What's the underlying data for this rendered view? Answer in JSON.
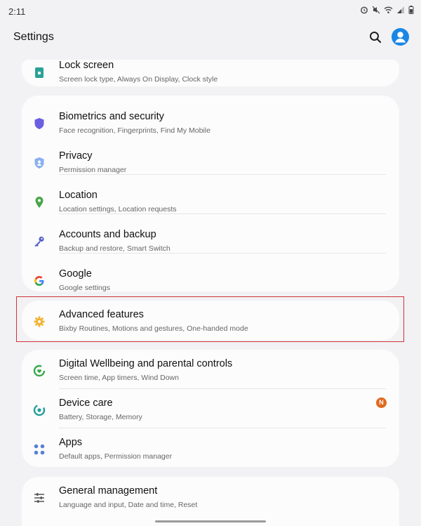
{
  "status_bar": {
    "time": "2:11",
    "icons": [
      "alarm-icon",
      "mute-icon",
      "wifi-icon",
      "signal-icon",
      "battery-icon"
    ]
  },
  "header": {
    "title": "Settings",
    "search_icon": "search-icon",
    "avatar_icon": "account-icon",
    "accent": "#1a86e6"
  },
  "items": {
    "lock_screen": {
      "title": "Lock screen",
      "subtitle": "Screen lock type, Always On Display, Clock style",
      "icon": "lock-icon",
      "color": "#2aa198"
    },
    "biometrics": {
      "title": "Biometrics and security",
      "subtitle": "Face recognition, Fingerprints, Find My Mobile",
      "icon": "shield-icon",
      "color": "#6a5fe0"
    },
    "privacy": {
      "title": "Privacy",
      "subtitle": "Permission manager",
      "icon": "privacy-shield-icon",
      "color": "#5a8ee8"
    },
    "location": {
      "title": "Location",
      "subtitle": "Location settings, Location requests",
      "icon": "location-pin-icon",
      "color": "#4aa64a"
    },
    "accounts": {
      "title": "Accounts and backup",
      "subtitle": "Backup and restore, Smart Switch",
      "icon": "key-icon",
      "color": "#5461c8"
    },
    "google": {
      "title": "Google",
      "subtitle": "Google settings",
      "icon": "google-icon",
      "color": "#4285f4"
    },
    "advanced": {
      "title": "Advanced features",
      "subtitle": "Bixby Routines, Motions and gestures, One-handed mode",
      "icon": "puzzle-gear-icon",
      "color": "#f2b233"
    },
    "wellbeing": {
      "title": "Digital Wellbeing and parental controls",
      "subtitle": "Screen time, App timers, Wind Down",
      "icon": "wellbeing-icon",
      "color": "#38a84a"
    },
    "device_care": {
      "title": "Device care",
      "subtitle": "Battery, Storage, Memory",
      "icon": "device-care-icon",
      "color": "#1f9e9a",
      "badge": "N"
    },
    "apps": {
      "title": "Apps",
      "subtitle": "Default apps, Permission manager",
      "icon": "apps-grid-icon",
      "color": "#5a7fd8"
    },
    "general": {
      "title": "General management",
      "subtitle": "Language and input, Date and time, Reset",
      "icon": "sliders-icon",
      "color": "#555555"
    }
  },
  "highlight_color": "#d2323c"
}
